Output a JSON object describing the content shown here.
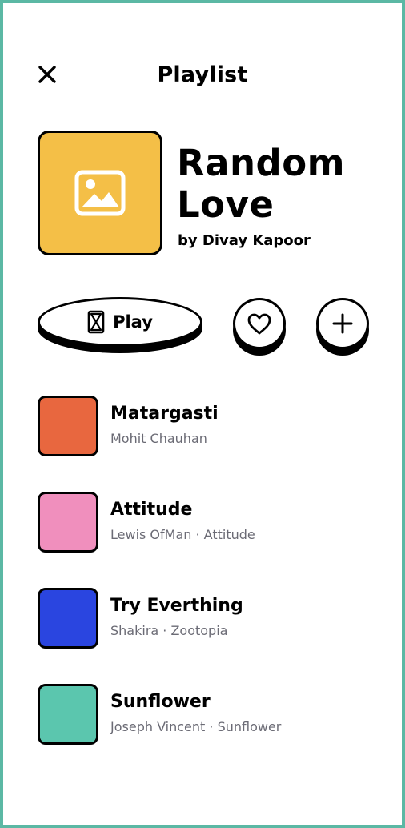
{
  "header": {
    "title": "Playlist",
    "close_icon": "close-icon"
  },
  "playlist": {
    "name": "Random Love",
    "author": "by Divay Kapoor",
    "cover_icon": "image-placeholder-icon",
    "cover_color": "#f4bf47"
  },
  "actions": {
    "play_label": "Play",
    "play_icon": "hourglass-icon",
    "like_icon": "heart-icon",
    "add_icon": "plus-icon"
  },
  "tracks": [
    {
      "title": "Matargasti",
      "subtitle": "Mohit Chauhan",
      "color": "#e8673f"
    },
    {
      "title": "Attitude",
      "subtitle": "Lewis OfMan · Attitude",
      "color": "#f08fbd"
    },
    {
      "title": "Try Everthing",
      "subtitle": "Shakira · Zootopia",
      "color": "#2a45e0"
    },
    {
      "title": "Sunflower",
      "subtitle": "Joseph Vincent · Sunflower",
      "color": "#5bc6ae"
    }
  ],
  "colors": {
    "frame": "#5bb8a4",
    "background": "#ffffff",
    "subtitle": "#6b6b75"
  }
}
